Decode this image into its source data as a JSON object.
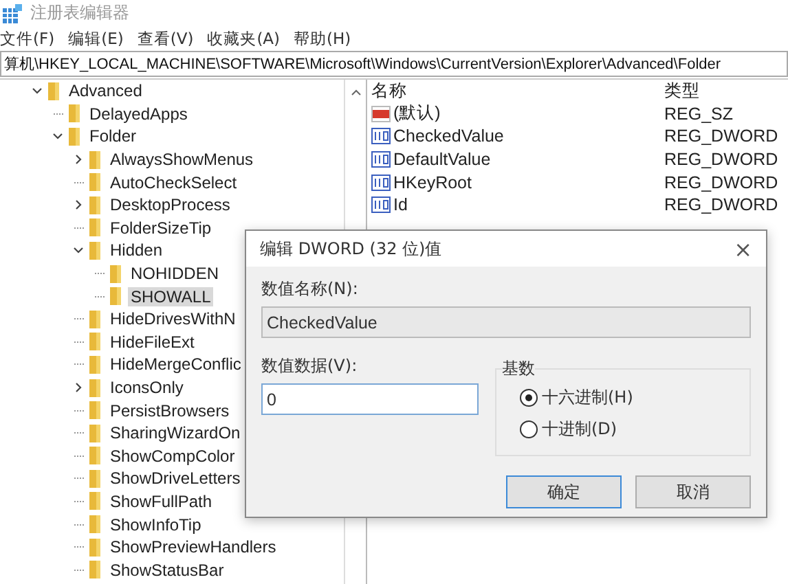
{
  "window": {
    "title": "注册表编辑器"
  },
  "menu": [
    "文件(F)",
    "编辑(E)",
    "查看(V)",
    "收藏夹(A)",
    "帮助(H)"
  ],
  "address": "算机\\HKEY_LOCAL_MACHINE\\SOFTWARE\\Microsoft\\Windows\\CurrentVersion\\Explorer\\Advanced\\Folder",
  "tree": [
    {
      "label": "Advanced",
      "kind": "branch",
      "expanded": true,
      "selected": false,
      "children": [
        {
          "label": "DelayedApps",
          "kind": "leaf",
          "selected": false
        },
        {
          "label": "Folder",
          "kind": "branch",
          "expanded": true,
          "selected": false,
          "children": [
            {
              "label": "AlwaysShowMenus",
              "kind": "branch",
              "expanded": false,
              "selected": false
            },
            {
              "label": "AutoCheckSelect",
              "kind": "leaf",
              "selected": false
            },
            {
              "label": "DesktopProcess",
              "kind": "branch",
              "expanded": false,
              "selected": false
            },
            {
              "label": "FolderSizeTip",
              "kind": "leaf",
              "selected": false
            },
            {
              "label": "Hidden",
              "kind": "branch",
              "expanded": true,
              "selected": false,
              "children": [
                {
                  "label": "NOHIDDEN",
                  "kind": "leaf",
                  "selected": false
                },
                {
                  "label": "SHOWALL",
                  "kind": "leaf",
                  "selected": true
                }
              ]
            },
            {
              "label": "HideDrivesWithN",
              "kind": "leaf",
              "selected": false
            },
            {
              "label": "HideFileExt",
              "kind": "leaf",
              "selected": false
            },
            {
              "label": "HideMergeConflic",
              "kind": "leaf",
              "selected": false
            },
            {
              "label": "IconsOnly",
              "kind": "branch",
              "expanded": false,
              "selected": false
            },
            {
              "label": "PersistBrowsers",
              "kind": "leaf",
              "selected": false
            },
            {
              "label": "SharingWizardOn",
              "kind": "leaf",
              "selected": false
            },
            {
              "label": "ShowCompColor",
              "kind": "leaf",
              "selected": false
            },
            {
              "label": "ShowDriveLetters",
              "kind": "leaf",
              "selected": false
            },
            {
              "label": "ShowFullPath",
              "kind": "leaf",
              "selected": false
            },
            {
              "label": "ShowInfoTip",
              "kind": "leaf",
              "selected": false
            },
            {
              "label": "ShowPreviewHandlers",
              "kind": "leaf",
              "selected": false
            },
            {
              "label": "ShowStatusBar",
              "kind": "leaf",
              "selected": false
            }
          ]
        }
      ]
    }
  ],
  "values": {
    "columns": [
      "名称",
      "类型"
    ],
    "rows": [
      {
        "kind": "string",
        "name": "(默认)",
        "type": "REG_SZ"
      },
      {
        "kind": "binary",
        "name": "CheckedValue",
        "type": "REG_DWORD"
      },
      {
        "kind": "binary",
        "name": "DefaultValue",
        "type": "REG_DWORD"
      },
      {
        "kind": "binary",
        "name": "HKeyRoot",
        "type": "REG_DWORD"
      },
      {
        "kind": "binary",
        "name": "Id",
        "type": "REG_DWORD"
      }
    ]
  },
  "dialog": {
    "title": "编辑 DWORD (32 位)值",
    "close": "×",
    "name_label": "数值名称(N):",
    "name_value": "CheckedValue",
    "data_label": "数值数据(V):",
    "data_value": "0",
    "base_label": "基数",
    "radios": [
      {
        "label": "十六进制(H)",
        "selected": true
      },
      {
        "label": "十进制(D)",
        "selected": false
      }
    ],
    "buttons": [
      {
        "label": "确定",
        "focused": true
      },
      {
        "label": "取消",
        "focused": false
      }
    ]
  }
}
